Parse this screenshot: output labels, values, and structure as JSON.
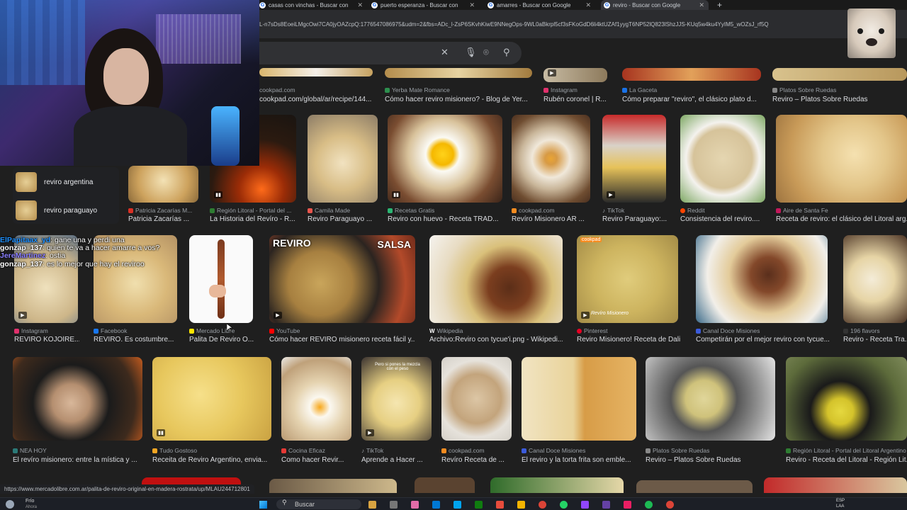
{
  "browser": {
    "tabs": [
      {
        "label": "casas con vinchas - Buscar con",
        "active": false
      },
      {
        "label": "puerto esperanza - Buscar con",
        "active": false
      },
      {
        "label": "amarres - Buscar con Google",
        "active": false
      },
      {
        "label": "reviro - Buscar con Google",
        "active": true
      }
    ],
    "url": "L-n7sDs8EoeiLMgcOwi7CA0jyOAZcpQ:1776547086975&udm=2&fbs=ADc_l-ZsP6SKvhKiwE9NNegOps-9WL0aBkrpl5cf3sFKoGdD6li4ktUZAf1yygT6NP52lQ823lShzJJS-KUq5w4ku4YyIM5_wOZsJ_rf5Q",
    "status_url": "https://www.mercadolibre.com.ar/palita-de-reviro-original-en-madera-rostrata/up/MLAU244712801"
  },
  "suggestions": [
    {
      "label": "reviro argentina"
    },
    {
      "label": "reviro paraguayo"
    }
  ],
  "chat": [
    {
      "user": "ElPapitaax_yd",
      "message": ": gane una y perdi una"
    },
    {
      "user": "gonzap_137",
      "message": ": quien te va a hacer amarre a vos?"
    },
    {
      "user": "JereMartinez",
      "message": ": ostia"
    },
    {
      "user": "gonzap_137",
      "message": ": es lo mejor que hay el reviroo"
    }
  ],
  "results": {
    "row0": [
      {
        "source": "cookpad.com",
        "title": "cookpad.com/global/ar/recipe/144..."
      },
      {
        "source": "Yerba Mate Romance",
        "title": "Cómo hacer reviro misionero? - Blog de Yer..."
      },
      {
        "source": "Instagram",
        "title": "Rubén coronel | R..."
      },
      {
        "source": "La Gaceta",
        "title": "Cómo preparar \"reviro\", el clásico plato d..."
      },
      {
        "source": "Platos Sobre Ruedas",
        "title": "Reviro – Platos Sobre Ruedas"
      }
    ],
    "row1": [
      {
        "source": "Patricia Zacarías M...",
        "title": "Patricia Zacarías ..."
      },
      {
        "source": "Región Litoral - Portal del ...",
        "title": "La Historia del Revíro - R..."
      },
      {
        "source": "Camila Made",
        "title": "Reviro Paraguayo ..."
      },
      {
        "source": "Recetas Gratis",
        "title": "Reviro con huevo - Receta TRAD..."
      },
      {
        "source": "cookpad.com",
        "title": "Revíro Misionero AR ..."
      },
      {
        "source": "TikTok",
        "title": "Reviro Paraguayo:..."
      },
      {
        "source": "Reddit",
        "title": "Consistencia del reviro...."
      },
      {
        "source": "Aire de Santa Fe",
        "title": "Receta de reviro: el clásico del Litoral arg..."
      }
    ],
    "row2": [
      {
        "source": "Instagram",
        "title": "REVIRO KOJOÍRE..."
      },
      {
        "source": "Facebook",
        "title": "REVIRO. Es costumbre..."
      },
      {
        "source": "Mercado Libre",
        "title": "Palita De Reviro O..."
      },
      {
        "source": "YouTube",
        "title": "Cómo hacer REVIRO misionero receta fácil y..."
      },
      {
        "source": "Wikipedia",
        "title": "Archivo:Reviro con tycue'i.png - Wikipedi..."
      },
      {
        "source": "Pinterest",
        "title": "Reviro Misionero! Receta de Dali"
      },
      {
        "source": "Canal Doce Misiones",
        "title": "Competirán por el mejor reviro con tycue..."
      },
      {
        "source": "196 flavors",
        "title": "Reviro - Receta Tra..."
      }
    ],
    "row3": [
      {
        "source": "NEA HOY",
        "title": "El revíro misionero: entre la mística y ..."
      },
      {
        "source": "Tudo Gostoso",
        "title": "Receita de Reviro Argentino, envia..."
      },
      {
        "source": "Cocina Eficaz",
        "title": "Como hacer Revir..."
      },
      {
        "source": "TikTok",
        "title": "Aprende a Hacer ..."
      },
      {
        "source": "cookpad.com",
        "title": "Revíro Receta de ..."
      },
      {
        "source": "Canal Doce Misiones",
        "title": "El reviro y la torta frita son emble..."
      },
      {
        "source": "Platos Sobre Ruedas",
        "title": "Reviro – Platos Sobre Ruedas"
      },
      {
        "source": "Región Litoral - Portal del Litoral Argentino",
        "title": "Reviro - Receta del Litoral - Región Lit..."
      }
    ],
    "overlay_text": {
      "reviro": "REVIRO",
      "salsa": "SALSA",
      "cookpad_badge": "cookpad",
      "misionero": "Revíro Misionero",
      "tiktok_caption": "Pero si pones la mezcla con el peso"
    }
  },
  "taskbar": {
    "weather": "Frío",
    "weather_sub": "Ahora",
    "search_placeholder": "Buscar",
    "lang": "ESP",
    "lang_sub": "LAA"
  },
  "colors": {
    "background": "#1f1f1f",
    "accent_blue": "#8ab4f8",
    "text": "#e8eaed",
    "muted": "#9aa0a6"
  }
}
